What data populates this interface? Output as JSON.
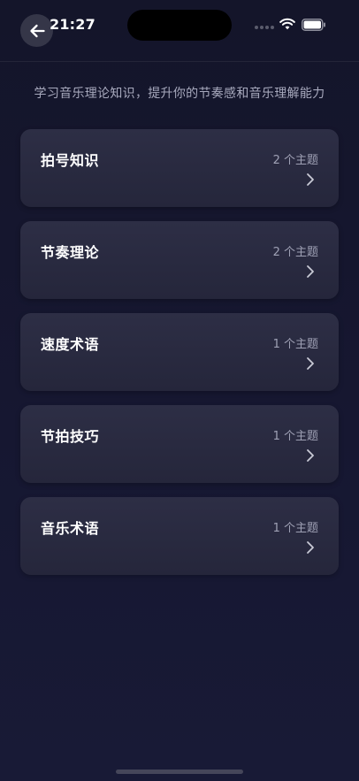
{
  "status_bar": {
    "time": "21:27"
  },
  "header": {
    "back_icon": "arrow-left-icon"
  },
  "subtitle": "学习音乐理论知识，提升你的节奏感和音乐理解能力",
  "categories": [
    {
      "title": "拍号知识",
      "count": "2 个主题"
    },
    {
      "title": "节奏理论",
      "count": "2 个主题"
    },
    {
      "title": "速度术语",
      "count": "1 个主题"
    },
    {
      "title": "节拍技巧",
      "count": "1 个主题"
    },
    {
      "title": "音乐术语",
      "count": "1 个主题"
    }
  ],
  "colors": {
    "background": "#161731",
    "card": "#2a2b42",
    "subtitle_text": "#a7a9bd",
    "count_text": "#9fa1b5"
  }
}
